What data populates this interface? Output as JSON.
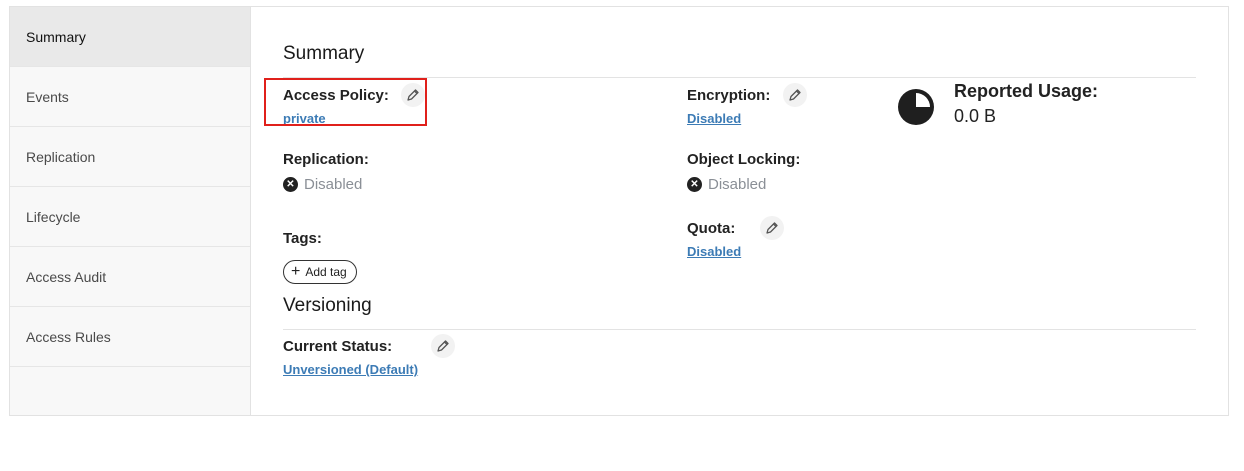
{
  "sidebar": {
    "items": [
      {
        "label": "Summary",
        "active": true
      },
      {
        "label": "Events"
      },
      {
        "label": "Replication"
      },
      {
        "label": "Lifecycle"
      },
      {
        "label": "Access Audit"
      },
      {
        "label": "Access Rules"
      }
    ]
  },
  "summary": {
    "title": "Summary",
    "access_policy": {
      "label": "Access Policy:",
      "value": "private"
    },
    "encryption": {
      "label": "Encryption:",
      "value": "Disabled"
    },
    "reported_usage": {
      "label": "Reported Usage:",
      "value": "0.0 B"
    },
    "replication": {
      "label": "Replication:",
      "value": "Disabled"
    },
    "object_locking": {
      "label": "Object Locking:",
      "value": "Disabled"
    },
    "tags": {
      "label": "Tags:",
      "add_label": "Add tag"
    },
    "quota": {
      "label": "Quota:",
      "value": "Disabled"
    }
  },
  "versioning": {
    "title": "Versioning",
    "current_status": {
      "label": "Current Status:",
      "value": "Unversioned (Default)"
    }
  },
  "colors": {
    "link": "#3c7bb5",
    "highlight": "#e0201b",
    "disabled_text": "#8a8f96"
  }
}
